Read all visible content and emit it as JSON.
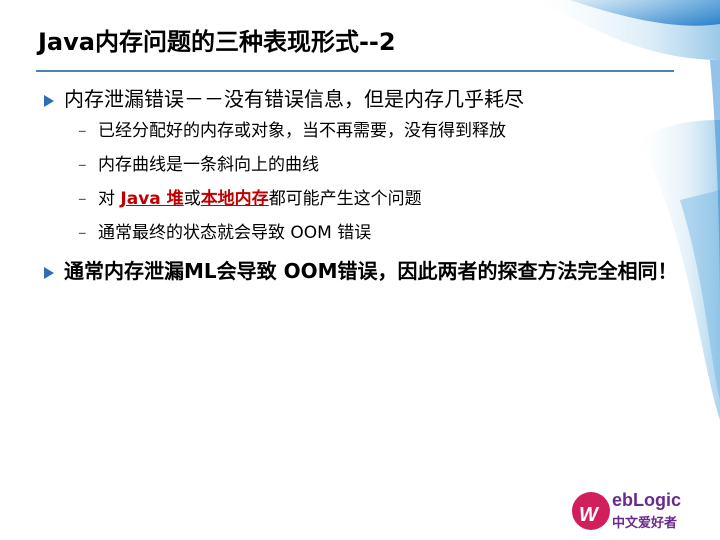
{
  "slide": {
    "title": "Java内存问题的三种表现形式--2",
    "bullet1": {
      "text": "内存泄漏错误－－没有错误信息，但是内存几乎耗尽",
      "subs": [
        "已经分配好的内存或对象，当不再需要，没有得到释放",
        "内存曲线是一条斜向上的曲线"
      ],
      "sub3_prefix": "对 ",
      "sub3_link1": "Java 堆",
      "sub3_mid": "或",
      "sub3_link2": "本地内存",
      "sub3_suffix": "都可能产生这个问题",
      "sub4": "通常最终的状态就会导致 OOM 错误"
    },
    "bullet2": {
      "text": "通常内存泄漏ML会导致 OOM错误，因此两者的探查方法完全相同！"
    },
    "logo": {
      "line1": "ebLogic",
      "line2": "中文爱好者"
    }
  },
  "colors": {
    "accent_blue": "#2f6db5",
    "link_red": "#c00000",
    "logo_purple": "#6a2b8c"
  }
}
